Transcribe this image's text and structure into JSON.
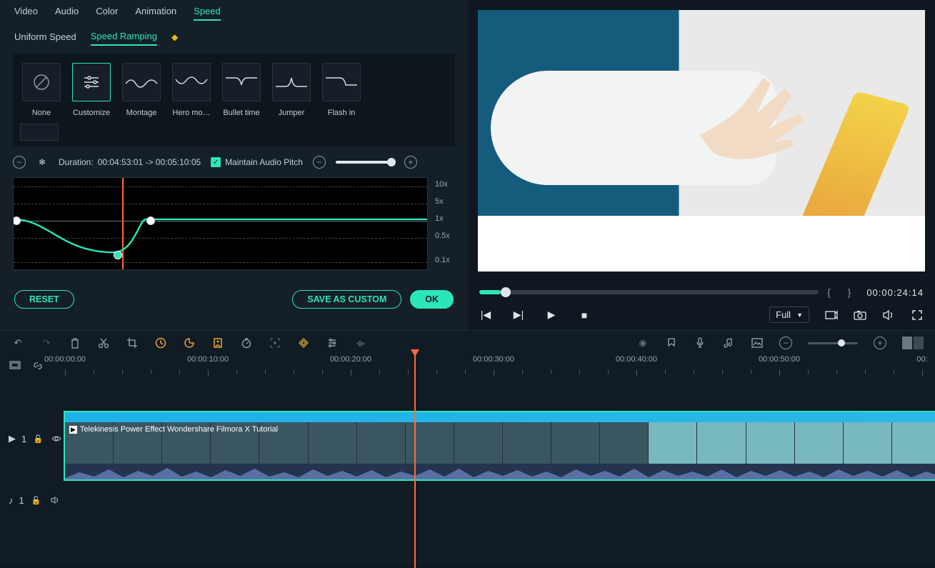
{
  "tabs": {
    "video": "Video",
    "audio": "Audio",
    "color": "Color",
    "animation": "Animation",
    "speed": "Speed"
  },
  "subtabs": {
    "uniform": "Uniform Speed",
    "ramping": "Speed Ramping"
  },
  "presets": [
    {
      "id": "none",
      "label": "None"
    },
    {
      "id": "customize",
      "label": "Customize"
    },
    {
      "id": "montage",
      "label": "Montage"
    },
    {
      "id": "heromoment",
      "label": "Hero mo…"
    },
    {
      "id": "bullettime",
      "label": "Bullet time"
    },
    {
      "id": "jumper",
      "label": "Jumper"
    },
    {
      "id": "flashin",
      "label": "Flash in"
    }
  ],
  "curve": {
    "duration_label": "Duration:",
    "duration_value": "00:04:53:01 -> 00:05:10:05",
    "maintain": "Maintain Audio Pitch",
    "speed_ticks": [
      "10x",
      "5x",
      "1x",
      "0.5x",
      "0.1x"
    ]
  },
  "buttons": {
    "reset": "RESET",
    "save": "SAVE AS CUSTOM",
    "ok": "OK"
  },
  "preview": {
    "timecode": "00:00:24:14",
    "quality": "Full"
  },
  "ruler": [
    "00:00:00:00",
    "00:00:10:00",
    "00:00:20:00",
    "00:00:30:00",
    "00:00:40:00",
    "00:00:50:00",
    "00:"
  ],
  "clip": {
    "title": "Telekinesis Power Effect   Wondershare Filmora X Tutorial"
  },
  "tracks": {
    "video": "1",
    "audio": "1"
  }
}
